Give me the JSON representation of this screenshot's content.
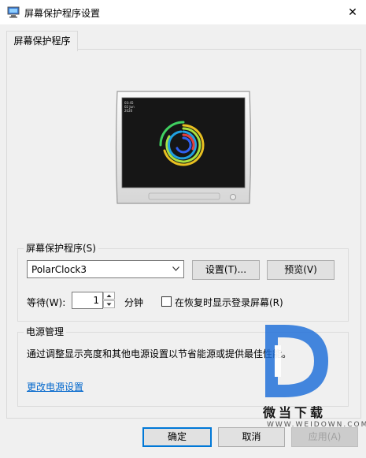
{
  "window": {
    "title": "屏幕保护程序设置",
    "close_symbol": "✕"
  },
  "tab": {
    "label": "屏幕保护程序"
  },
  "screensaver": {
    "group_label": "屏幕保护程序(S)",
    "selected": "PolarClock3",
    "settings_button": "设置(T)...",
    "preview_button": "预览(V)",
    "wait_label": "等待(W):",
    "wait_value": "1",
    "minutes_label": "分钟",
    "resume_checkbox_label": "在恢复时显示登录屏幕(R)",
    "resume_checked": false
  },
  "preview": {
    "clock_lines": [
      "03:45",
      "02 Jun",
      "2020"
    ]
  },
  "power": {
    "group_label": "电源管理",
    "description": "通过调整显示亮度和其他电源设置以节省能源或提供最佳性能。",
    "link": "更改电源设置"
  },
  "footer": {
    "ok": "确定",
    "cancel": "取消",
    "apply": "应用(A)"
  },
  "watermark": {
    "brand": "微当下载",
    "url": "WWW.WEIDOWN.COM"
  },
  "colors": {
    "accent": "#0078d7",
    "link": "#0066cc",
    "watermark_blue": "#1e6fd9"
  }
}
